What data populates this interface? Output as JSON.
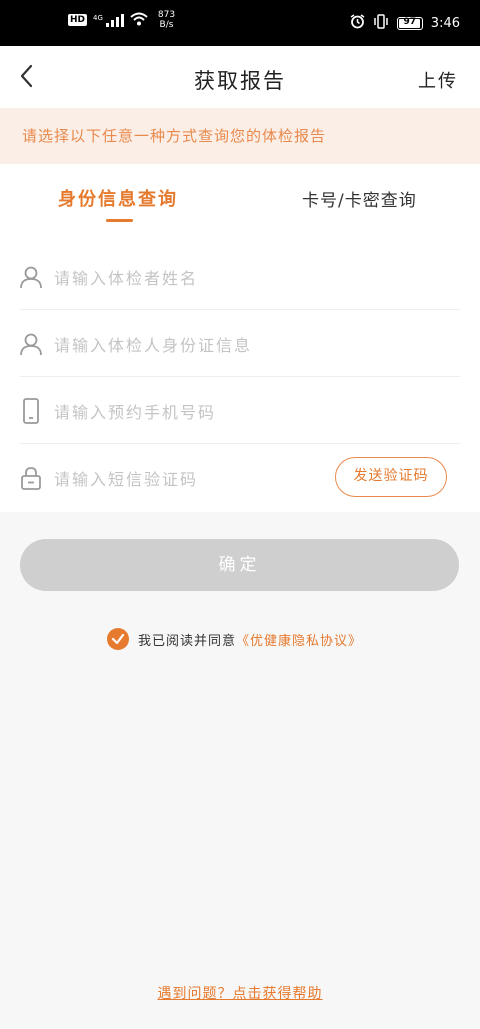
{
  "status_bar": {
    "hd_badge": "HD",
    "signal": "4G",
    "net_speed_value": "873",
    "net_speed_unit": "B/s",
    "battery": "97",
    "battery_level": 0.97,
    "time": "3:46"
  },
  "header": {
    "title": "获取报告",
    "upload_label": "上传"
  },
  "notice": "请选择以下任意一种方式查询您的体检报告",
  "tabs": [
    {
      "label": "身份信息查询",
      "active": true
    },
    {
      "label": "卡号/卡密查询",
      "active": false
    }
  ],
  "form": {
    "name_placeholder": "请输入体检者姓名",
    "id_placeholder": "请输入体检人身份证信息",
    "phone_placeholder": "请输入预约手机号码",
    "code_placeholder": "请输入短信验证码",
    "send_code_label": "发送验证码"
  },
  "confirm_label": "确定",
  "agreement": {
    "checked": true,
    "prefix": "我已阅读并同意",
    "link": "《优健康隐私协议》"
  },
  "help_link": "遇到问题？点击获得帮助",
  "colors": {
    "accent": "#e67a2e",
    "notice_bg": "#fbeee6",
    "button_disabled": "#cfcfcf"
  }
}
